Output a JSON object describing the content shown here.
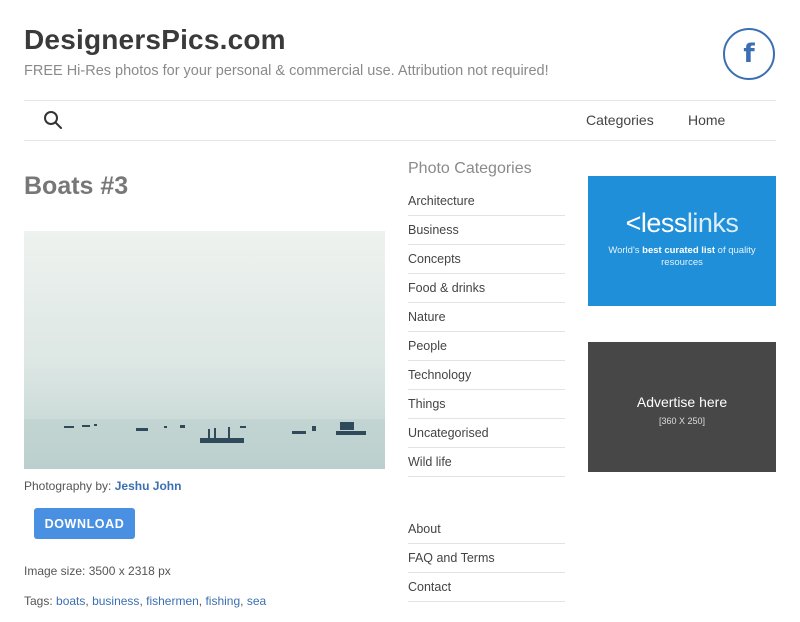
{
  "site": {
    "title": "DesignersPics.com",
    "tagline": "FREE Hi-Res photos for your personal & commercial use. Attribution not required!",
    "facebook_glyph": "f"
  },
  "nav": {
    "search_icon": "search-icon",
    "links": [
      "Categories",
      "Home"
    ]
  },
  "post": {
    "title": "Boats #3",
    "credit_prefix": "Photography by:",
    "photographer": "Jeshu John",
    "download_label": "DOWNLOAD",
    "image_size": "Image size: 3500 x 2318 px",
    "tags_prefix": "Tags:",
    "tags": [
      "boats",
      "business",
      "fishermen",
      "fishing",
      "sea"
    ]
  },
  "sidebar": {
    "categories_title": "Photo Categories",
    "categories": [
      "Architecture",
      "Business",
      "Concepts",
      "Food & drinks",
      "Nature",
      "People",
      "Technology",
      "Things",
      "Uncategorised",
      "Wild life"
    ],
    "pages": [
      "About",
      "FAQ and Terms",
      "Contact"
    ]
  },
  "ads": {
    "lesslinks": {
      "logo_lt": "<",
      "logo_less": "less",
      "logo_links": "links",
      "tag_pre": "World's",
      "tag_bold": "best curated list",
      "tag_post": "of quality resources"
    },
    "advertise": {
      "text": "Advertise here",
      "size": "[360 X 250]"
    }
  },
  "colors": {
    "link": "#3b6fb3",
    "button": "#4a90e2",
    "lesslinks_bg": "#1e8fd8",
    "advertise_bg": "#474747"
  }
}
